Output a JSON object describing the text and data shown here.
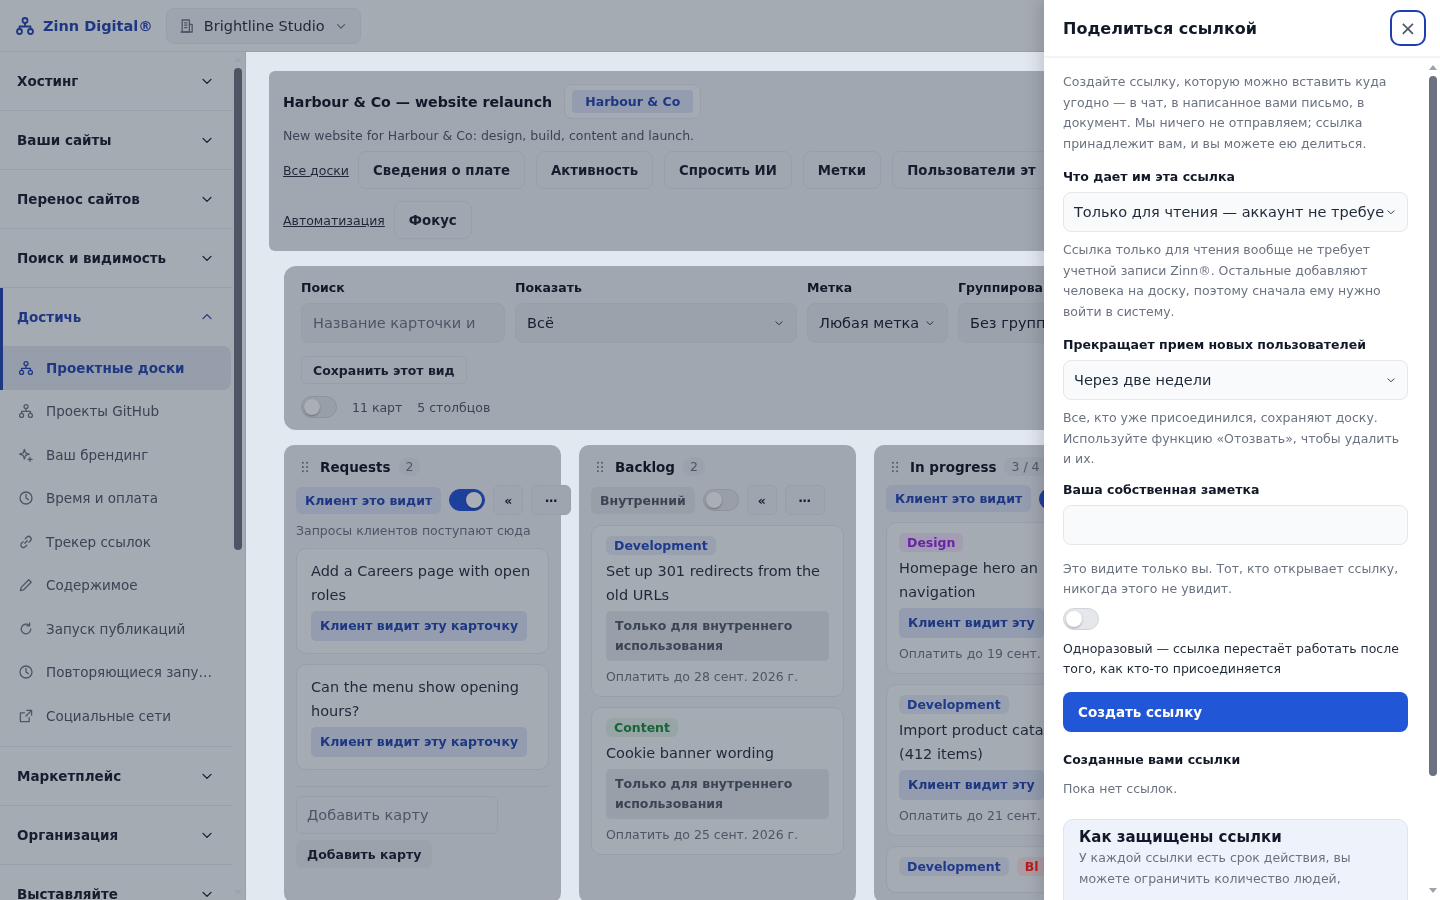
{
  "header": {
    "brand": "Zinn Digital®",
    "workspace": "Brightline Studio"
  },
  "sidebar": {
    "sections": [
      {
        "label": "Хостинг",
        "expanded": false
      },
      {
        "label": "Ваши сайты",
        "expanded": false
      },
      {
        "label": "Перенос сайтов",
        "expanded": false
      },
      {
        "label": "Поиск и видимость",
        "expanded": false
      },
      {
        "label": "Достичь",
        "expanded": true,
        "items": [
          {
            "label": "Проектные доски",
            "selected": true
          },
          {
            "label": "Проекты GitHub",
            "selected": false
          },
          {
            "label": "Ваш брендинг",
            "selected": false
          },
          {
            "label": "Время и оплата",
            "selected": false
          },
          {
            "label": "Трекер ссылок",
            "selected": false
          },
          {
            "label": "Содержимое",
            "selected": false
          },
          {
            "label": "Запуск публикаций",
            "selected": false
          },
          {
            "label": "Повторяющиеся запу…",
            "selected": false
          },
          {
            "label": "Социальные сети",
            "selected": false
          }
        ]
      },
      {
        "label": "Маркетплейс",
        "expanded": false
      },
      {
        "label": "Организация",
        "expanded": false
      },
      {
        "label": "Выставляйте",
        "expanded": false
      }
    ]
  },
  "board": {
    "title": "Harbour & Co — website relaunch",
    "client": "Harbour & Co",
    "description": "New website for Harbour & Co: design, build, content and launch.",
    "nav_rows": [
      [
        {
          "kind": "link",
          "label": "Все доски"
        },
        {
          "kind": "button",
          "label": "Сведения о плате"
        },
        {
          "kind": "button",
          "label": "Активность"
        },
        {
          "kind": "button",
          "label": "Спросить ИИ"
        },
        {
          "kind": "button",
          "label": "Метки"
        },
        {
          "kind": "button",
          "label": "Пользователи эт"
        }
      ],
      [
        {
          "kind": "link",
          "label": "Автоматизация"
        },
        {
          "kind": "button",
          "label": "Фокус"
        }
      ]
    ],
    "filters": {
      "search": {
        "label": "Поиск",
        "placeholder": "Название карточки и"
      },
      "show": {
        "label": "Показать",
        "value": "Всё"
      },
      "tag": {
        "label": "Метка",
        "value": "Любая метка"
      },
      "group": {
        "label": "Группирова",
        "value": "Без групп"
      },
      "save_view": "Сохранить этот вид",
      "toggle_on": false,
      "card_count": "11 карт",
      "column_count": "5 столбцов"
    },
    "columns": [
      {
        "title": "Requests",
        "count": "2",
        "visibility": {
          "kind": "client",
          "label": "Клиент это видит",
          "on": true
        },
        "collapse": "«",
        "more": "⋯",
        "note": "Запросы клиентов поступают сюда",
        "cards": [
          {
            "title": "Add a Careers page with open roles",
            "visibility": {
              "kind": "client",
              "label": "Клиент видит эту карточку"
            }
          },
          {
            "title": "Can the menu show opening hours?",
            "visibility": {
              "kind": "client",
              "label": "Клиент видит эту карточку"
            }
          }
        ],
        "add_placeholder": "Добавить карту",
        "add_button": "Добавить карту"
      },
      {
        "title": "Backlog",
        "count": "2",
        "visibility": {
          "kind": "internal",
          "label": "Внутренний",
          "on": false
        },
        "collapse": "«",
        "more": "⋯",
        "cards": [
          {
            "tags": [
              {
                "label": "Development",
                "color": "#1e3a8a"
              }
            ],
            "title": "Set up 301 redirects from the old URLs",
            "visibility": {
              "kind": "internal",
              "label": "Только для внутреннего использования"
            },
            "due": "Оплатить до 28 сент. 2026 г."
          },
          {
            "tags": [
              {
                "label": "Content",
                "color": "#166534"
              }
            ],
            "title": "Cookie banner wording",
            "visibility": {
              "kind": "internal",
              "label": "Только для внутреннего использования"
            },
            "due": "Оплатить до 25 сент. 2026 г."
          }
        ]
      },
      {
        "title": "In progress",
        "count": "3 / 4",
        "visibility": {
          "kind": "client",
          "label": "Клиент это видит",
          "on": true
        },
        "cards": [
          {
            "tags": [
              {
                "label": "Design",
                "color": "#6b21a8"
              }
            ],
            "title": "Homepage hero an navigation",
            "visibility": {
              "kind": "client",
              "label": "Клиент видит эту"
            },
            "due": "Оплатить до 19 сент."
          },
          {
            "tags": [
              {
                "label": "Development",
                "color": "#1e3a8a"
              }
            ],
            "title": "Import product cata (412 items)",
            "visibility": {
              "kind": "client",
              "label": "Клиент видит эту"
            },
            "due": "Оплатить до 21 сент."
          },
          {
            "tags": [
              {
                "label": "Development",
                "color": "#1e3a8a"
              },
              {
                "label": "Bl",
                "color": "#b91c1c"
              }
            ]
          }
        ]
      }
    ]
  },
  "share_drawer": {
    "title": "Поделиться ссылкой",
    "close": "×",
    "intro": "Создайте ссылку, которую можно вставить куда угодно — в чат, в написанное вами письмо, в документ. Мы ничего не отправляем; ссылка принадлежит вам, и вы можете ею делиться.",
    "access": {
      "label": "Что дает им эта ссылка",
      "value": "Только для чтения — аккаунт не требуе"
    },
    "access_help": "Ссылка только для чтения вообще не требует учетной записи Zinn®. Остальные добавляют человека на доску, поэтому сначала ему нужно войти в систему.",
    "expiry": {
      "label": "Прекращает прием новых пользователей",
      "value": "Через две недели"
    },
    "expiry_help": "Все, кто уже присоединился, сохраняют доску. Используйте функцию «Отозвать», чтобы удалить и их.",
    "note": {
      "label": "Ваша собственная заметка"
    },
    "note_help": "Это видите только вы. Тот, кто открывает ссылку, никогда этого не увидит.",
    "single_use": {
      "on": false,
      "label": "Одноразовый — ссылка перестаёт работать после того, как кто-то присоединяется"
    },
    "create_button": "Создать ссылку",
    "links": {
      "title": "Созданные вами ссылки",
      "empty": "Пока нет ссылок."
    },
    "info": {
      "title": "Как защищены ссылки",
      "text": "У каждой ссылки есть срок действия, вы можете ограничить количество людей,"
    }
  }
}
